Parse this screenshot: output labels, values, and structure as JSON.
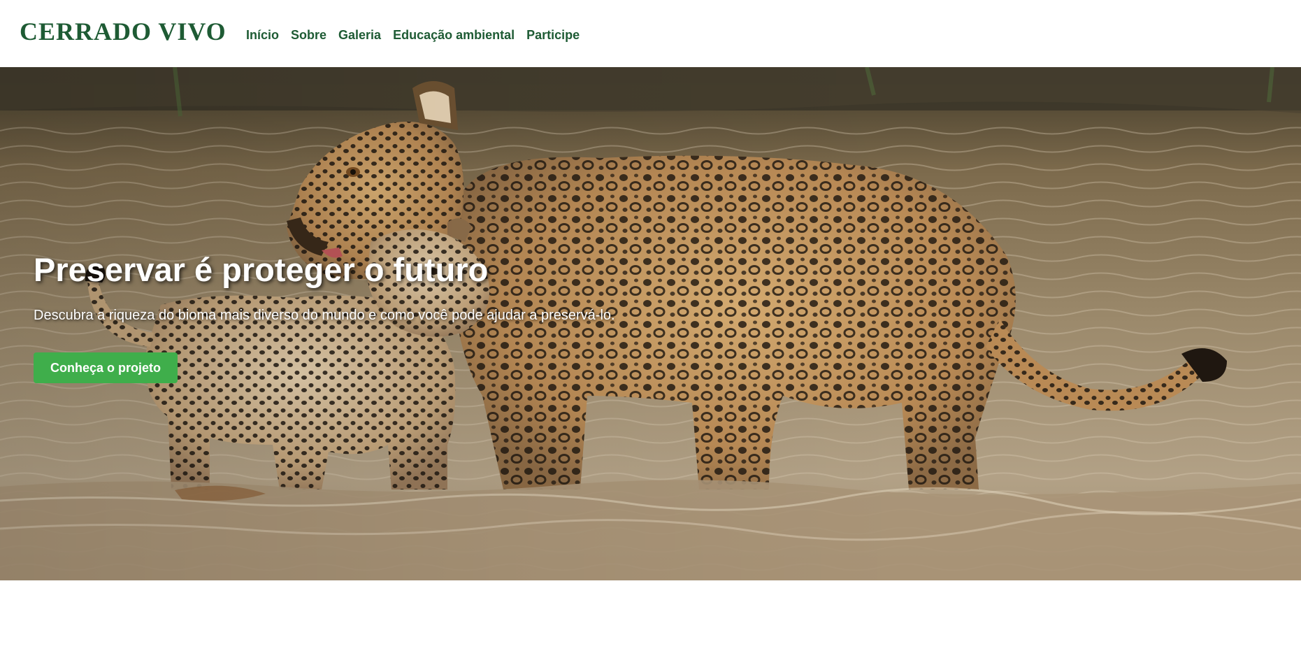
{
  "header": {
    "logo": "CERRADO VIVO",
    "nav": [
      {
        "label": "Início"
      },
      {
        "label": "Sobre"
      },
      {
        "label": "Galeria"
      },
      {
        "label": "Educação ambiental"
      },
      {
        "label": "Participe"
      }
    ]
  },
  "hero": {
    "title": "Preservar é proteger o futuro",
    "subtitle": "Descubra a riqueza do bioma mais diverso do mundo e como você pode ajudar a preservá-lo.",
    "cta_label": "Conheça o projeto",
    "image_subject": "jaguar mother and cub standing in a river"
  },
  "colors": {
    "brand_green": "#1e5b34",
    "button_green": "#3fae4b",
    "background": "#ffffff"
  }
}
